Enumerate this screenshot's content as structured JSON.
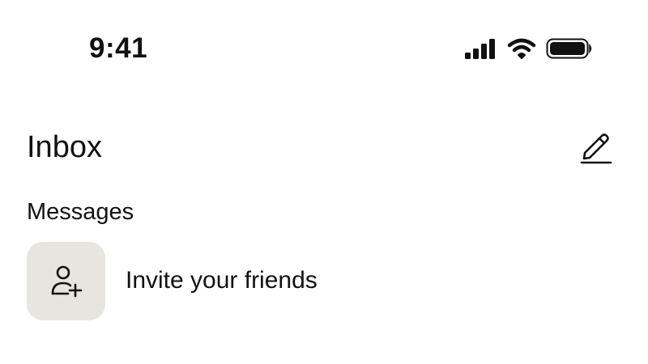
{
  "status_bar": {
    "time": "9:41",
    "icons": [
      "signal-icon",
      "wifi-icon",
      "battery-icon"
    ]
  },
  "header": {
    "title": "Inbox",
    "compose_icon": "pencil-icon"
  },
  "messages": {
    "section_label": "Messages",
    "invite_label": "Invite your friends",
    "invite_icon": "add-person-icon"
  },
  "colors": {
    "text": "#111111",
    "background": "#ffffff",
    "tile_background": "#e6e5df"
  }
}
